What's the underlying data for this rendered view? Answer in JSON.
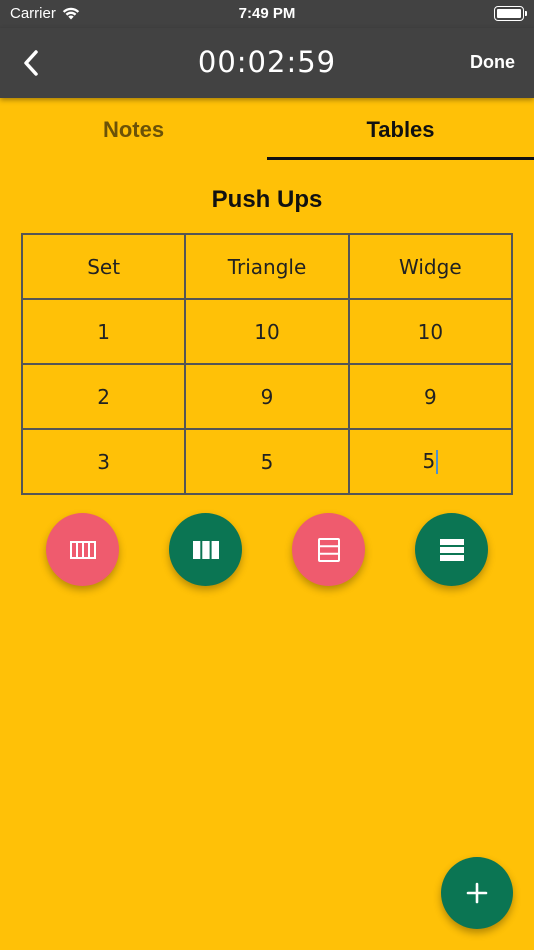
{
  "status_bar": {
    "carrier": "Carrier",
    "time": "7:49 PM",
    "wifi_icon": "wifi-icon",
    "battery_icon": "battery-icon",
    "battery_level": 1.0
  },
  "app_bar": {
    "timer": "00:02:59",
    "done_label": "Done",
    "back_icon": "chevron-left-icon",
    "background_color": "#424242"
  },
  "tabs": [
    {
      "label": "Notes",
      "selected": false
    },
    {
      "label": "Tables",
      "selected": true
    }
  ],
  "table": {
    "title": "Push Ups",
    "headers": [
      "Set",
      "Triangle",
      "Widge"
    ],
    "rows": [
      [
        "1",
        "10",
        "10"
      ],
      [
        "2",
        "9",
        "9"
      ],
      [
        "3",
        "5",
        "5"
      ]
    ]
  },
  "actions": [
    {
      "icon": "remove-column-icon",
      "color": "#EF5B6E"
    },
    {
      "icon": "add-column-icon",
      "color": "#0B7553"
    },
    {
      "icon": "remove-row-icon",
      "color": "#EF5B6E"
    },
    {
      "icon": "add-row-icon",
      "color": "#0B7553"
    }
  ],
  "add_button": {
    "icon": "plus-icon",
    "color": "#0B7553"
  },
  "colors": {
    "background": "#FFC107",
    "accent_green": "#0B7553",
    "accent_red": "#EF5B6E"
  }
}
